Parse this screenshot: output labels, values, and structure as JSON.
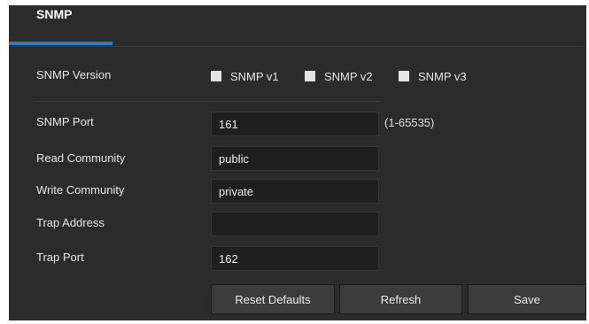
{
  "tab": {
    "label": "SNMP"
  },
  "version": {
    "label": "SNMP Version",
    "options": [
      "SNMP v1",
      "SNMP v2",
      "SNMP v3"
    ]
  },
  "port": {
    "label": "SNMP Port",
    "value": "161",
    "hint": "(1-65535)"
  },
  "read_community": {
    "label": "Read Community",
    "value": "public"
  },
  "write_community": {
    "label": "Write Community",
    "value": "private"
  },
  "trap_address": {
    "label": "Trap Address",
    "value": ""
  },
  "trap_port": {
    "label": "Trap Port",
    "value": "162"
  },
  "buttons": {
    "reset": "Reset Defaults",
    "refresh": "Refresh",
    "save": "Save"
  }
}
